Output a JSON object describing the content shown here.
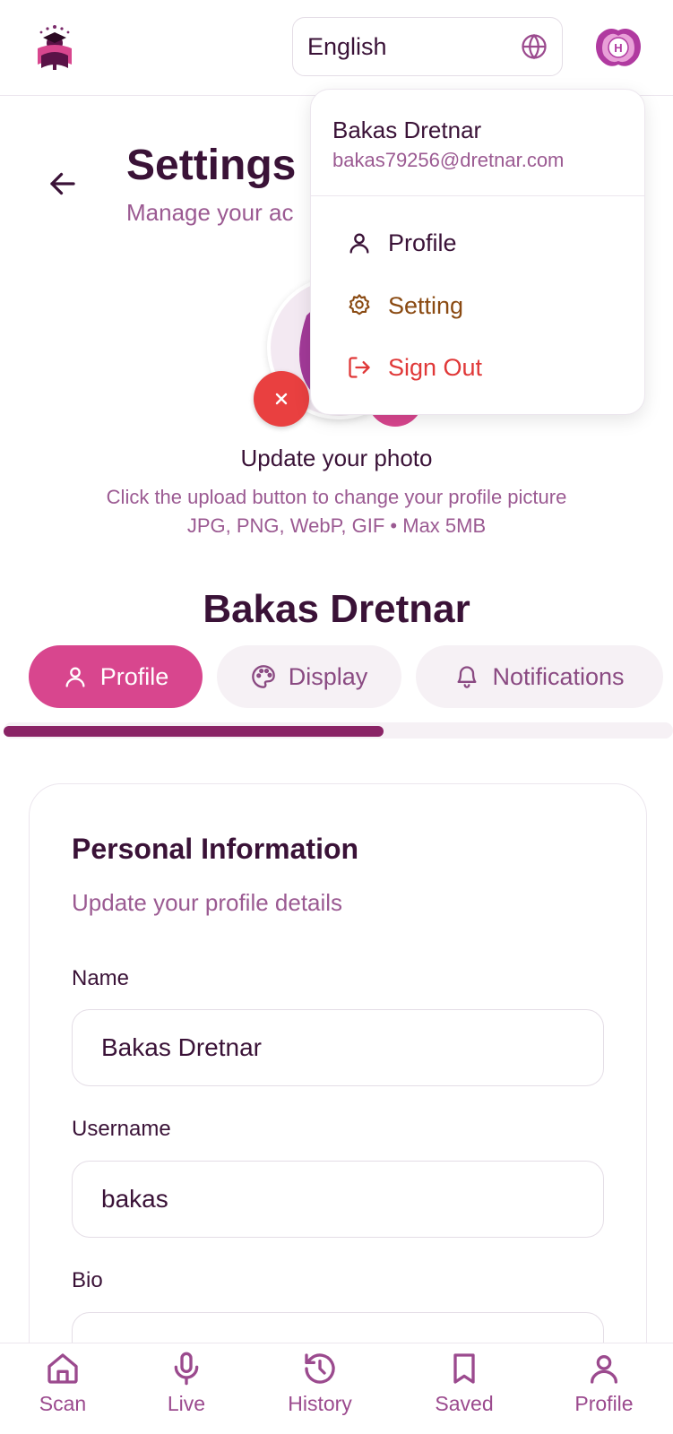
{
  "header": {
    "language": "English",
    "avatar_initial": "H"
  },
  "page": {
    "title": "Settings",
    "subtitle": "Manage your ac"
  },
  "photo": {
    "title": "Update your photo",
    "help": "Click the upload button to change your profile picture",
    "formats": "JPG, PNG, WebP, GIF • Max 5MB"
  },
  "user": {
    "display_name": "Bakas Dretnar"
  },
  "tabs": [
    {
      "label": "Profile",
      "active": true
    },
    {
      "label": "Display",
      "active": false
    },
    {
      "label": "Notifications",
      "active": false
    }
  ],
  "progress": 0.57,
  "card": {
    "title": "Personal Information",
    "subtitle": "Update your profile details",
    "fields": {
      "name": {
        "label": "Name",
        "value": "Bakas Dretnar"
      },
      "username": {
        "label": "Username",
        "value": "bakas"
      },
      "bio": {
        "label": "Bio",
        "value": ""
      }
    }
  },
  "menu": {
    "name": "Bakas Dretnar",
    "email": "bakas79256@dretnar.com",
    "items": [
      {
        "label": "Profile",
        "icon": "user-icon"
      },
      {
        "label": "Setting",
        "icon": "gear-icon"
      },
      {
        "label": "Sign Out",
        "icon": "sign-out-icon"
      }
    ]
  },
  "nav": [
    {
      "label": "Scan",
      "icon": "home-icon"
    },
    {
      "label": "Live",
      "icon": "microphone-icon"
    },
    {
      "label": "History",
      "icon": "history-icon"
    },
    {
      "label": "Saved",
      "icon": "bookmark-icon"
    },
    {
      "label": "Profile",
      "icon": "user-icon"
    }
  ],
  "colors": {
    "primary": "#d8468e",
    "dark_text": "#3a1237",
    "muted_text": "#9b5a92",
    "danger": "#e94040",
    "setting_item": "#8a4a12",
    "progress_fill": "#8a2466"
  }
}
